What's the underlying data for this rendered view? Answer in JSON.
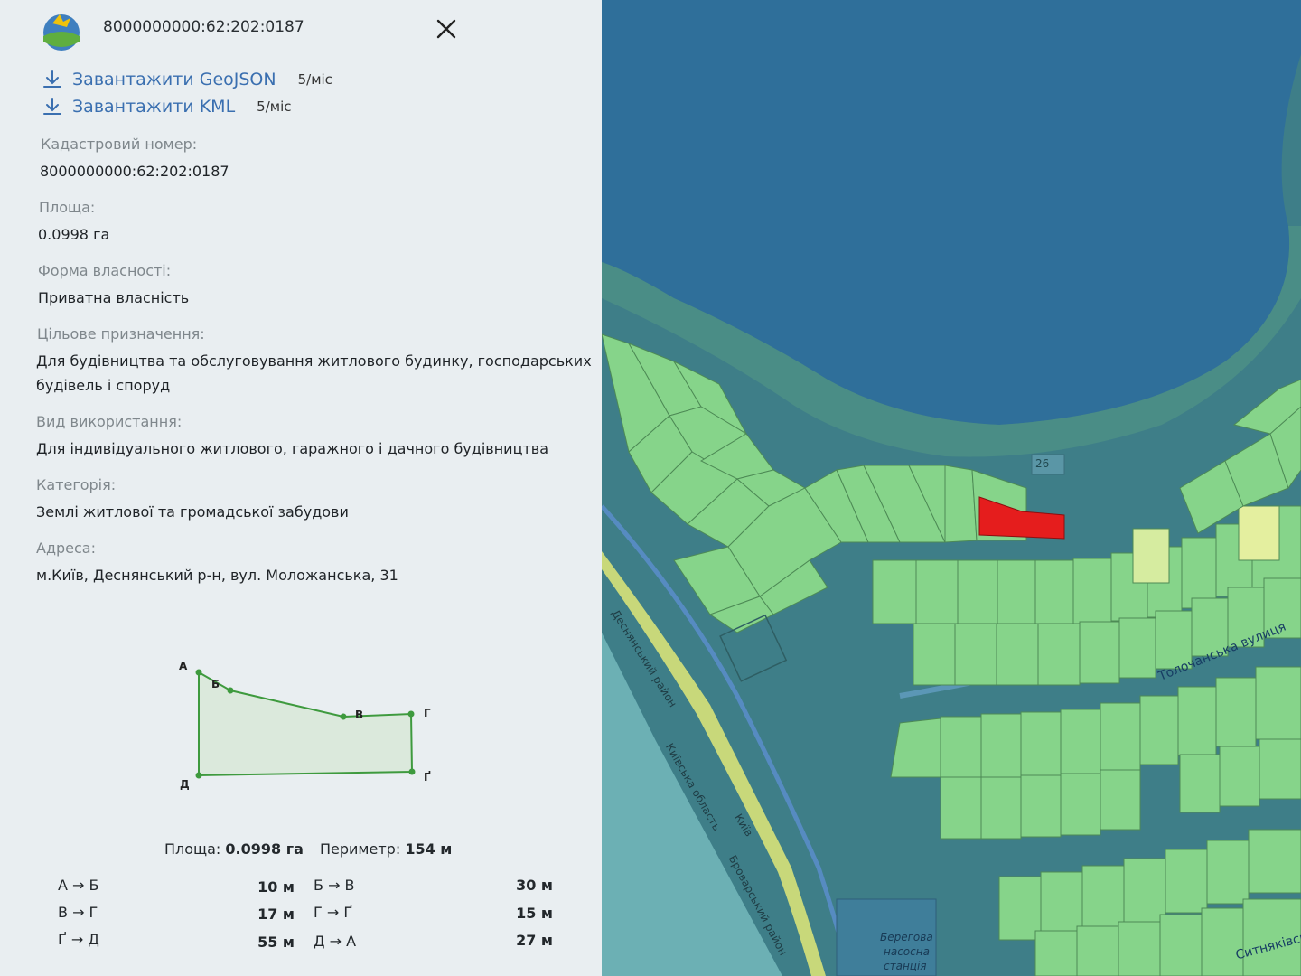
{
  "header": {
    "title": "8000000000:62:202:0187"
  },
  "downloads": [
    {
      "label": "Завантажити GeoJSON",
      "limit": "5/міс"
    },
    {
      "label": "Завантажити KML",
      "limit": "5/міс"
    }
  ],
  "fields": [
    {
      "label": "Кадастровий номер:",
      "value": "8000000000:62:202:0187"
    },
    {
      "label": "Площа:",
      "value": "0.0998 га"
    },
    {
      "label": "Форма власності:",
      "value": "Приватна власність"
    },
    {
      "label": "Цільове призначення:",
      "value_line1": "Для будівництва та обслуговування житлового будинку, господарських",
      "value_line2": "будівель і споруд"
    },
    {
      "label": "Вид використання:",
      "value": "Для індивідуального житлового, гаражного і дачного будівництва"
    },
    {
      "label": "Категорія:",
      "value": "Землі житлової та громадської забудови"
    },
    {
      "label": "Адреса:",
      "value": "м.Київ, Деснянський р-н, вул. Моложанська, 31"
    }
  ],
  "plot": {
    "vertices": [
      "А",
      "Б",
      "В",
      "Г",
      "Ґ",
      "Д"
    ]
  },
  "summary": {
    "area_label": "Площа:",
    "area_value": "0.0998 га",
    "perimeter_label": "Периметр:",
    "perimeter_value": "154 м"
  },
  "segments": [
    {
      "name": "А → Б",
      "length": "10 м"
    },
    {
      "name": "Б → В",
      "length": "30 м"
    },
    {
      "name": "В → Г",
      "length": "17 м"
    },
    {
      "name": "Г → Ґ",
      "length": "15 м"
    },
    {
      "name": "Ґ → Д",
      "length": "55 м"
    },
    {
      "name": "Д → А",
      "length": "27 м"
    }
  ],
  "map": {
    "road_number": "26",
    "labels": {
      "street1": "Толочанська вулиця",
      "district1": "Деснянський район",
      "region": "Київська область",
      "city": "Київ",
      "district2": "Броварський район",
      "station_line1": "Берегова",
      "station_line2": "насосна",
      "station_line3": "станція",
      "street2": "Ситняківсь"
    },
    "colors": {
      "water": "#2f6f9a",
      "parcel": "#86d48a",
      "selected": "#e51d1d"
    }
  }
}
